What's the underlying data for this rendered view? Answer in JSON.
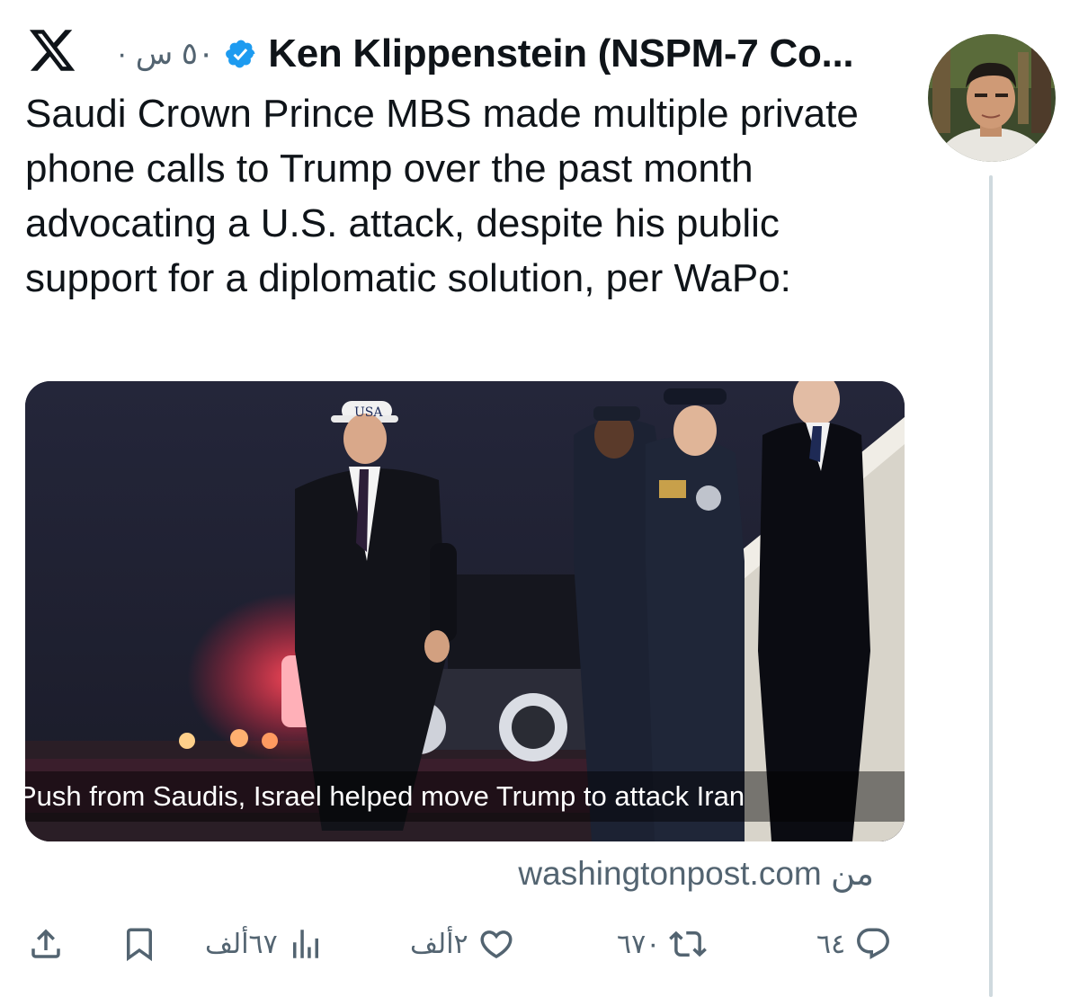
{
  "header": {
    "platform_icon": "x-logo-icon",
    "author_name": "Ken Klippenstein (NSPM-7 Co...",
    "verified_icon": "verified-badge-icon",
    "time": "٥٠ س ·"
  },
  "tweet": {
    "text": "Saudi Crown Prince MBS made multiple private phone calls to Trump over the past month advocating a U.S. attack, despite his public support for a diplomatic solution, per WaPo:"
  },
  "card": {
    "image_caption": "Push from Saudis, Israel helped move Trump to attack Iran",
    "cap_text": "USA",
    "source": "من washingtonpost.com"
  },
  "actions": {
    "replies": "٦٤",
    "retweets": "٦٧٠",
    "likes": "٢ألف",
    "views": "٦٧ألف"
  },
  "colors": {
    "text": "#0f1419",
    "muted": "#536471",
    "verified": "#1d9bf0",
    "thread_line": "#cfd9de"
  }
}
